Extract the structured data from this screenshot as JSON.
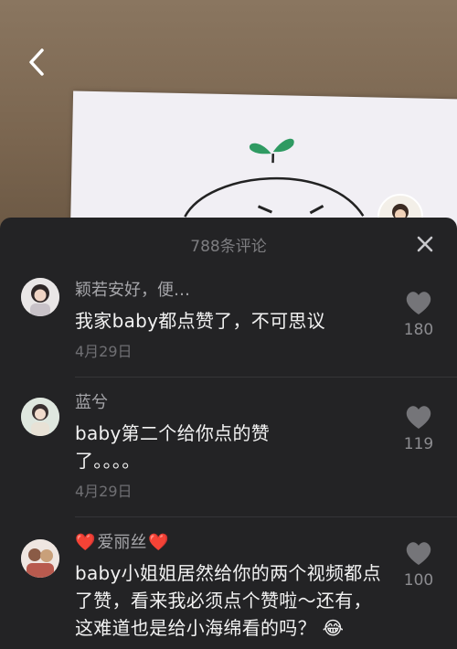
{
  "header": {
    "title": "788条评论"
  },
  "comments": [
    {
      "username": "颖若安好，便…",
      "text": "我家baby都点赞了，不可思议",
      "date": "4月29日",
      "likes": "180"
    },
    {
      "username": "蓝兮",
      "text": "baby第二个给你点的赞了。。。。",
      "date": "4月29日",
      "likes": "119"
    },
    {
      "username_prefix": "❤️",
      "username": "爱丽丝",
      "username_suffix": "❤️",
      "text": "baby小姐姐居然给你的两个视频都点了赞，看来我必须点个赞啦～还有，这难道也是给小海绵看的吗？",
      "emoji": "😂",
      "likes": "100"
    }
  ],
  "colors": {
    "panel_bg": "#232325",
    "heart_red": "#e8333a",
    "text_primary": "#f2f2f2",
    "text_secondary": "#a6a6aa"
  },
  "icons": [
    "back-chevron-icon",
    "close-icon",
    "heart-icon"
  ]
}
